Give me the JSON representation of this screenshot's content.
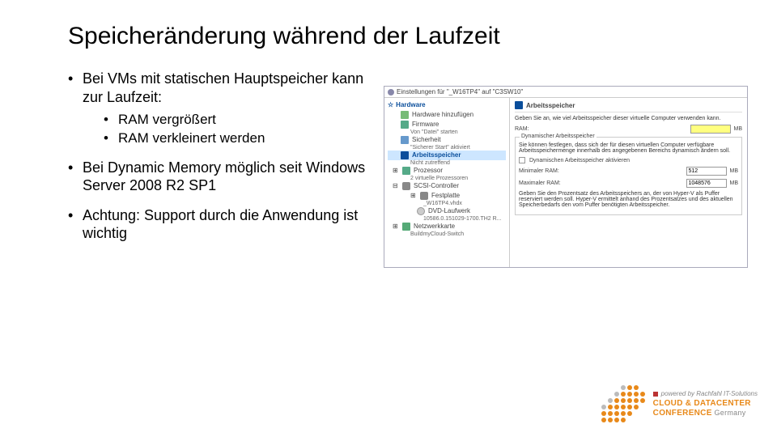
{
  "title": "Speicheränderung während der Laufzeit",
  "bullets": {
    "b1": "Bei VMs mit statischen Hauptspeicher kann zur Laufzeit:",
    "b1s1": "RAM vergrößert",
    "b1s2": "RAM verkleinert werden",
    "b2": "Bei Dynamic Memory möglich seit Windows Server 2008 R2 SP1",
    "b3": "Achtung: Support durch die Anwendung ist wichtig"
  },
  "screenshot": {
    "window_title": "Einstellungen für \"_W16TP4\" auf \"C3SW10\"",
    "left": {
      "hardware": "Hardware",
      "add_hw": "Hardware hinzufügen",
      "firmware": "Firmware",
      "firmware_sub": "Von \"Datei\" starten",
      "security": "Sicherheit",
      "security_sub": "\"Sicherer Start\" aktiviert",
      "memory": "Arbeitsspeicher",
      "memory_sub": "Nicht zutreffend",
      "cpu": "Prozessor",
      "cpu_sub": "2 virtuelle Prozessoren",
      "scsi": "SCSI-Controller",
      "hdd": "Festplatte",
      "hdd_sub": "_W16TP4.vhdx",
      "dvd": "DVD-Laufwerk",
      "dvd_sub": "10586.0.151029-1700.TH2 R...",
      "net": "Netzwerkkarte",
      "net_sub": "BuildmyCloud-Switch"
    },
    "right": {
      "header": "Arbeitsspeicher",
      "desc": "Geben Sie an, wie viel Arbeitsspeicher dieser virtuelle Computer verwenden kann.",
      "ram_label": "RAM:",
      "ram_value": "",
      "ram_unit": "MB",
      "group_title": "Dynamischer Arbeitsspeicher",
      "group_desc": "Sie können festlegen, dass sich der für diesen virtuellen Computer verfügbare Arbeitsspeichermenge innerhalb des angegebenen Bereichs dynamisch ändern soll.",
      "chk_label": "Dynamischen Arbeitsspeicher aktivieren",
      "min_label": "Minimaler RAM:",
      "min_value": "512",
      "min_unit": "MB",
      "max_label": "Maximaler RAM:",
      "max_value": "1048576",
      "max_unit": "MB",
      "footer_desc": "Geben Sie den Prozentsatz des Arbeitsspeichers an, der von Hyper-V als Puffer reserviert werden soll. Hyper-V ermittelt anhand des Prozentsatzes und des aktuellen Speicherbedarfs den vom Puffer benötigten Arbeitsspeicher."
    }
  },
  "footer": {
    "powered": "powered by Rachfahl IT-Solutions",
    "line1": "CLOUD & DATACENTER",
    "line2": "CONFERENCE",
    "line3": "Germany"
  }
}
